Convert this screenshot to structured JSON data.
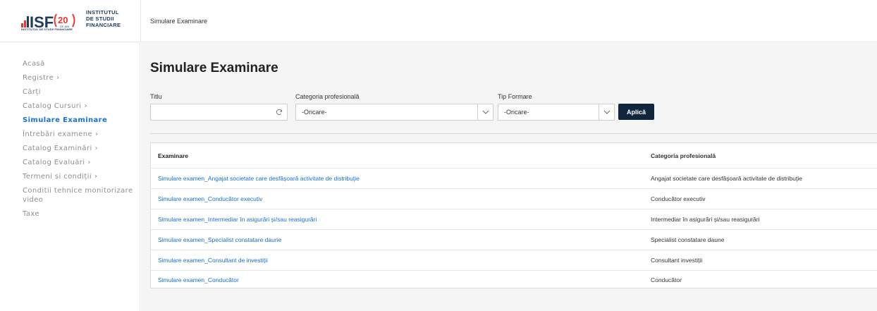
{
  "header": {
    "logo_mark": "ISF",
    "logo_anniversary": "20",
    "logo_anniversary_sub": "DE ANI",
    "logo_subtitle": "INSTITUTUL DE STUDII FINANCIARE",
    "logo_text_lines": [
      "INSTITUTUL",
      "DE STUDII",
      "FINANCIARE"
    ],
    "breadcrumb": "Simulare Examinare",
    "brand_color": "#1e3a5f",
    "accent_color": "#e63b2e"
  },
  "sidebar": {
    "items": [
      {
        "label": "Acasă",
        "has_children": false,
        "active": false
      },
      {
        "label": "Registre",
        "has_children": true,
        "active": false
      },
      {
        "label": "Cărți",
        "has_children": false,
        "active": false
      },
      {
        "label": "Catalog Cursuri",
        "has_children": true,
        "active": false
      },
      {
        "label": "Simulare Examinare",
        "has_children": false,
        "active": true
      },
      {
        "label": "Întrebări examene",
        "has_children": true,
        "active": false
      },
      {
        "label": "Catalog Examinări",
        "has_children": true,
        "active": false
      },
      {
        "label": "Catalog Evaluări",
        "has_children": true,
        "active": false
      },
      {
        "label": "Termeni si condiții",
        "has_children": true,
        "active": false
      },
      {
        "label": "Conditii tehnice monitorizare",
        "label2": "video",
        "has_children": false,
        "active": false
      },
      {
        "label": "Taxe",
        "has_children": false,
        "active": false
      }
    ],
    "active_color": "#1a6fd4"
  },
  "main": {
    "title": "Simulare Examinare",
    "filters": {
      "titlu_label": "Titlu",
      "titlu_value": "",
      "categorie_label": "Categoria profesională",
      "categorie_value": "-Oricare-",
      "tip_label": "Tip Formare",
      "tip_value": "-Oricare-",
      "apply_label": "Aplică"
    },
    "table": {
      "headers": [
        "Examinare",
        "Categoria profesională"
      ],
      "rows": [
        [
          "Simulare examen_Angajat societate care desfășoară activitate de distribuție",
          "Angajat societate care desfășoară activitate de distribuție"
        ],
        [
          "Simulare examen_Conducător executiv",
          "Conducător executiv"
        ],
        [
          "Simulare examen_Intermediar în asigurări și/sau reasigurări",
          "Intermediar în asigurări și/sau reasigurări"
        ],
        [
          "Simulare examen_Specialist constatare daune",
          "Specialist constatare daune"
        ],
        [
          "Simulare examen_Consultant de investiții",
          "Consultant investiții"
        ],
        [
          "Simulare examen_Conducător",
          "Conducător"
        ]
      ]
    },
    "link_color": "#1a6fd4",
    "button_color": "#10263d"
  },
  "icons": {
    "refresh": "refresh-icon",
    "chevron": "chevron-down-icon",
    "nav_chevron": "chevron-right-icon"
  }
}
